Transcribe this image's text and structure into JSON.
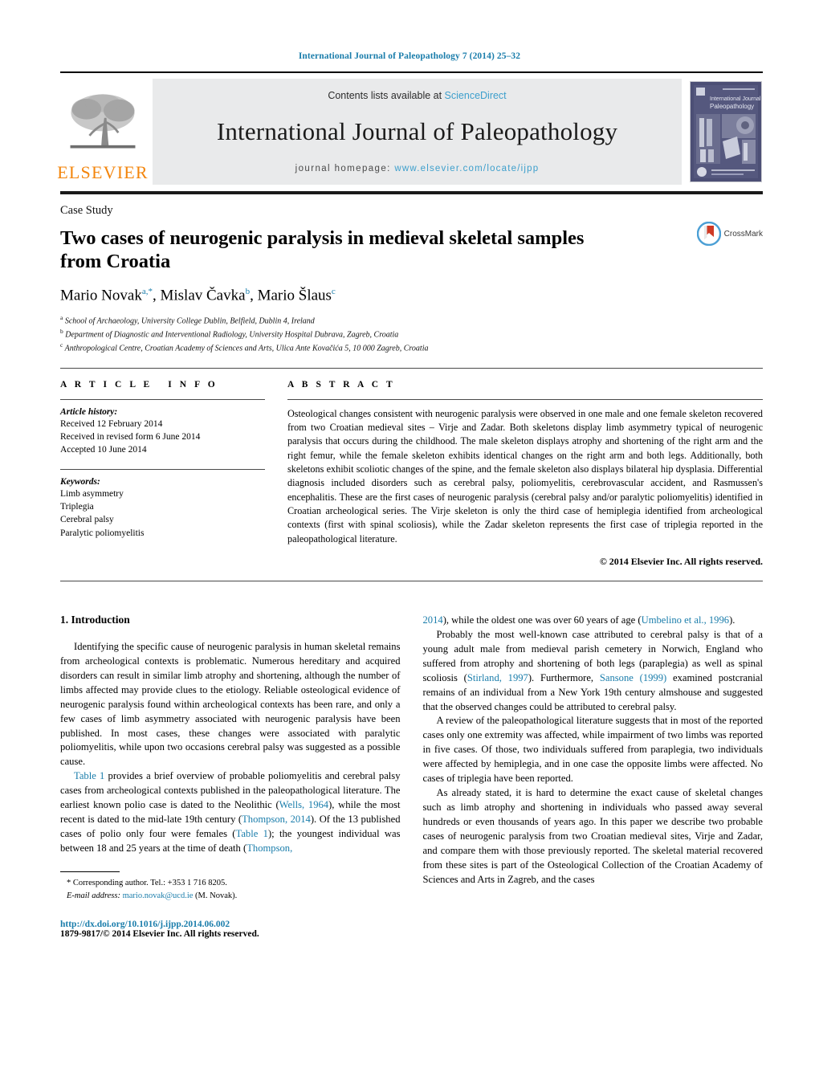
{
  "running_head": "International Journal of Paleopathology 7 (2014) 25–32",
  "masthead": {
    "publisher_name": "ELSEVIER",
    "contents_prefix": "Contents lists available at ",
    "contents_link": "ScienceDirect",
    "journal_title": "International Journal of Paleopathology",
    "homepage_prefix": "journal homepage: ",
    "homepage_url": "www.elsevier.com/locate/ijpp",
    "cover_title_line1": "International Journal of",
    "cover_title_line2": "Paleopathology"
  },
  "article": {
    "doctype": "Case Study",
    "title": "Two cases of neurogenic paralysis in medieval skeletal samples from Croatia",
    "authors_html": "Mario Novak<sup>a,*</sup>, Mislav Čavka<sup>b</sup>, Mario Šlaus<sup>c</sup>",
    "affiliations": [
      {
        "marker": "a",
        "text": "School of Archaeology, University College Dublin, Belfield, Dublin 4, Ireland"
      },
      {
        "marker": "b",
        "text": "Department of Diagnostic and Interventional Radiology, University Hospital Dubrava, Zagreb, Croatia"
      },
      {
        "marker": "c",
        "text": "Anthropological Centre, Croatian Academy of Sciences and Arts, Ulica Ante Kovačića 5, 10 000 Zagreb, Croatia"
      }
    ],
    "crossmark_label": "CrossMark"
  },
  "article_info": {
    "heading": "ARTICLE INFO",
    "history_label": "Article history:",
    "history": [
      "Received 12 February 2014",
      "Received in revised form 6 June 2014",
      "Accepted 10 June 2014"
    ],
    "keywords_label": "Keywords:",
    "keywords": [
      "Limb asymmetry",
      "Triplegia",
      "Cerebral palsy",
      "Paralytic poliomyelitis"
    ]
  },
  "abstract": {
    "heading": "ABSTRACT",
    "text": "Osteological changes consistent with neurogenic paralysis were observed in one male and one female skeleton recovered from two Croatian medieval sites – Virje and Zadar. Both skeletons display limb asymmetry typical of neurogenic paralysis that occurs during the childhood. The male skeleton displays atrophy and shortening of the right arm and the right femur, while the female skeleton exhibits identical changes on the right arm and both legs. Additionally, both skeletons exhibit scoliotic changes of the spine, and the female skeleton also displays bilateral hip dysplasia. Differential diagnosis included disorders such as cerebral palsy, poliomyelitis, cerebrovascular accident, and Rasmussen's encephalitis. These are the first cases of neurogenic paralysis (cerebral palsy and/or paralytic poliomyelitis) identified in Croatian archeological series. The Virje skeleton is only the third case of hemiplegia identified from archeological contexts (first with spinal scoliosis), while the Zadar skeleton represents the first case of triplegia reported in the paleopathological literature.",
    "copyright": "© 2014 Elsevier Inc. All rights reserved."
  },
  "body": {
    "section_heading": "1. Introduction",
    "left_paragraphs": [
      "Identifying the specific cause of neurogenic paralysis in human skeletal remains from archeological contexts is problematic. Numerous hereditary and acquired disorders can result in similar limb atrophy and shortening, although the number of limbs affected may provide clues to the etiology. Reliable osteological evidence of neurogenic paralysis found within archeological contexts has been rare, and only a few cases of limb asymmetry associated with neurogenic paralysis have been published. In most cases, these changes were associated with paralytic poliomyelitis, while upon two occasions cerebral palsy was suggested as a possible cause."
    ],
    "left_para2_parts": [
      {
        "t": "Table 1",
        "link": true
      },
      {
        "t": " provides a brief overview of probable poliomyelitis and cerebral palsy cases from archeological contexts published in the paleopathological literature. The earliest known polio case is dated to the Neolithic (",
        "link": false
      },
      {
        "t": "Wells, 1964",
        "link": true
      },
      {
        "t": "), while the most recent is dated to the mid-late 19th century (",
        "link": false
      },
      {
        "t": "Thompson, 2014",
        "link": true
      },
      {
        "t": "). Of the 13 published cases of polio only four were females (",
        "link": false
      },
      {
        "t": "Table 1",
        "link": true
      },
      {
        "t": "); the youngest individual was between 18 and 25 years at the time of death (",
        "link": false
      },
      {
        "t": "Thompson,",
        "link": true
      }
    ],
    "right_para1_parts": [
      {
        "t": "2014",
        "link": true
      },
      {
        "t": "), while the oldest one was over 60 years of age (",
        "link": false
      },
      {
        "t": "Umbelino et al., 1996",
        "link": true
      },
      {
        "t": ").",
        "link": false
      }
    ],
    "right_para2_parts": [
      {
        "t": "Probably the most well-known case attributed to cerebral palsy is that of a young adult male from medieval parish cemetery in Norwich, England who suffered from atrophy and shortening of both legs (paraplegia) as well as spinal scoliosis (",
        "link": false
      },
      {
        "t": "Stirland, 1997",
        "link": true
      },
      {
        "t": "). Furthermore, ",
        "link": false
      },
      {
        "t": "Sansone (1999)",
        "link": true
      },
      {
        "t": " examined postcranial remains of an individual from a New York 19th century almshouse and suggested that the observed changes could be attributed to cerebral palsy.",
        "link": false
      }
    ],
    "right_paragraphs": [
      "A review of the paleopathological literature suggests that in most of the reported cases only one extremity was affected, while impairment of two limbs was reported in five cases. Of those, two individuals suffered from paraplegia, two individuals were affected by hemiplegia, and in one case the opposite limbs were affected. No cases of triplegia have been reported.",
      "As already stated, it is hard to determine the exact cause of skeletal changes such as limb atrophy and shortening in individuals who passed away several hundreds or even thousands of years ago. In this paper we describe two probable cases of neurogenic paralysis from two Croatian medieval sites, Virje and Zadar, and compare them with those previously reported. The skeletal material recovered from these sites is part of the Osteological Collection of the Croatian Academy of Sciences and Arts in Zagreb, and the cases"
    ]
  },
  "footnote": {
    "corresponding": "* Corresponding author. Tel.: +353 1 716 8205.",
    "email_label": "E-mail address:",
    "email": "mario.novak@ucd.ie",
    "email_suffix": " (M. Novak)."
  },
  "doi": {
    "url": "http://dx.doi.org/10.1016/j.ijpp.2014.06.002",
    "issn_line": "1879-9817/© 2014 Elsevier Inc. All rights reserved."
  },
  "colors": {
    "link_blue": "#1a7dab",
    "light_blue": "#3d9fcc",
    "elsevier_orange": "#F3850C",
    "masthead_grey": "#e9eaeb"
  }
}
